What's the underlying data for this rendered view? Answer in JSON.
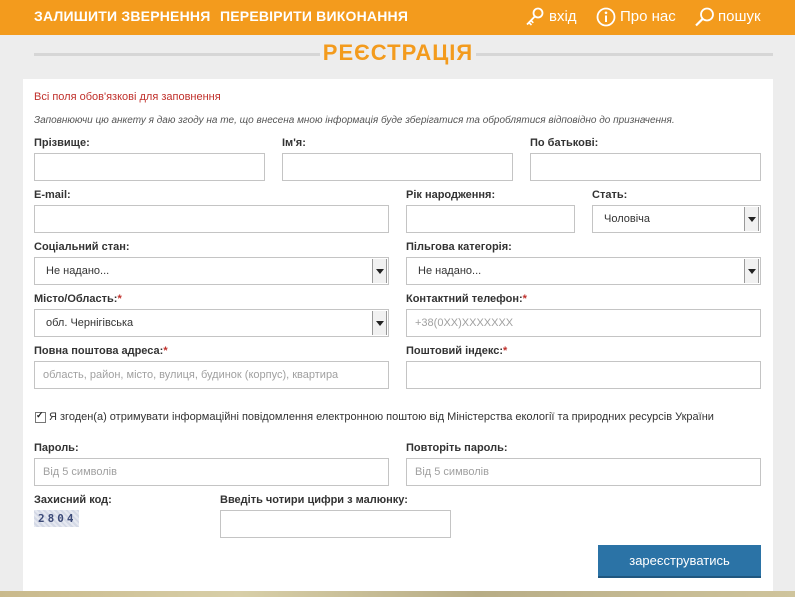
{
  "nav": {
    "left": [
      "ЗАЛИШИТИ ЗВЕРНЕННЯ",
      "ПЕРЕВІРИТИ ВИКОНАННЯ"
    ],
    "login": "вхід",
    "about": "Про нас",
    "search": "пошук"
  },
  "page_title": "РЕЄСТРАЦІЯ",
  "notes": {
    "required": "Всі поля обов'язкові для заповнення",
    "consent": "Заповнюючи цю анкету я даю згоду на те, що внесена мною інформація буде зберігатися та оброблятися відповідно до призначення."
  },
  "form": {
    "surname": {
      "label": "Прізвище:",
      "value": ""
    },
    "first_name": {
      "label": "Ім'я:",
      "value": ""
    },
    "patronymic": {
      "label": "По батькові:",
      "value": ""
    },
    "email": {
      "label": "E-mail:",
      "value": ""
    },
    "birth_year": {
      "label": "Рік народження:",
      "value": ""
    },
    "gender": {
      "label": "Стать:",
      "value": "Чоловіча"
    },
    "social_status": {
      "label": "Соціальний стан:",
      "value": "Не надано..."
    },
    "benefit_category": {
      "label": "Пільгова категорія:",
      "value": "Не надано..."
    },
    "city_region": {
      "label": "Місто/Область:",
      "value": "обл. Чернігівська"
    },
    "phone": {
      "label": "Контактний телефон:",
      "placeholder": "+38(0XX)XXXXXXX"
    },
    "postal_address": {
      "label": "Повна поштова адреса:",
      "placeholder": "область, район, місто, вулиця, будинок (корпус), квартира"
    },
    "postal_code": {
      "label": "Поштовий індекс:",
      "value": ""
    },
    "newsletter_consent": {
      "label": "Я згоден(а) отримувати інформаційні повідомлення електронною поштою від Міністерства екології та природних ресурсів України",
      "checked": true
    },
    "password": {
      "label": "Пароль:",
      "placeholder": "Від 5 символів"
    },
    "password_repeat": {
      "label": "Повторіть пароль:",
      "placeholder": "Від 5 символів"
    },
    "captcha": {
      "label": "Захисний код:",
      "code": "2804"
    },
    "captcha_input": {
      "label": "Введіть чотири цифри з малюнку:",
      "value": ""
    },
    "required_mark": "*",
    "submit": "зареєструватись"
  },
  "colors": {
    "accent": "#f39b1d",
    "button": "#2b73a6",
    "error": "#c0302b"
  }
}
